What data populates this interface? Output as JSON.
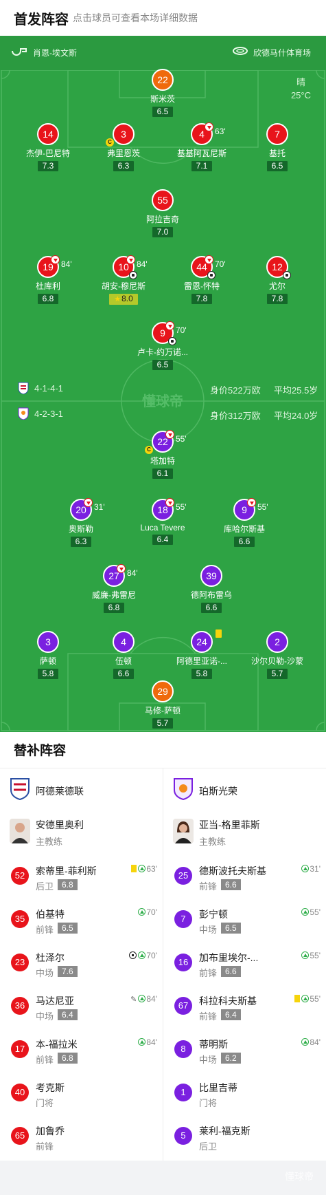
{
  "header": {
    "title": "首发阵容",
    "subtitle": "点击球员可查看本场详细数据"
  },
  "pitch_info": {
    "home_coach": "肖恩-埃文斯",
    "venue": "欣德马什体育场",
    "weather": "晴",
    "temperature": "25°C",
    "watermark": "懂球帝"
  },
  "home_meta": {
    "formation": "4-1-4-1",
    "value": "身价522万欧",
    "age": "平均25.5岁"
  },
  "away_meta": {
    "formation": "4-2-3-1",
    "value": "身价312万欧",
    "age": "平均24.0岁"
  },
  "home_players": [
    {
      "num": "22",
      "name": "斯米茨",
      "rating": "6.5"
    },
    {
      "num": "14",
      "name": "杰伊-巴尼特",
      "rating": "7.3"
    },
    {
      "num": "3",
      "name": "弗里恩茨",
      "rating": "6.3"
    },
    {
      "num": "4",
      "name": "基基阿瓦尼斯",
      "rating": "7.1",
      "sub_time": "63'"
    },
    {
      "num": "7",
      "name": "基托",
      "rating": "6.5"
    },
    {
      "num": "55",
      "name": "阿拉吉奇",
      "rating": "7.0"
    },
    {
      "num": "19",
      "name": "杜库利",
      "rating": "6.8",
      "sub_time": "84'"
    },
    {
      "num": "10",
      "name": "胡安-穆尼斯",
      "rating": "8.0",
      "sub_time": "84'"
    },
    {
      "num": "44",
      "name": "雷恩-怀特",
      "rating": "7.8",
      "sub_time": "70'"
    },
    {
      "num": "12",
      "name": "尤尔",
      "rating": "7.8"
    },
    {
      "num": "9",
      "name": "卢卡-约万诺...",
      "rating": "6.5",
      "sub_time": "70'"
    }
  ],
  "away_players": [
    {
      "num": "22",
      "name": "塔加特",
      "rating": "6.1",
      "sub_time": "55'"
    },
    {
      "num": "20",
      "name": "奥斯勒",
      "rating": "6.3",
      "sub_time": "31'"
    },
    {
      "num": "18",
      "name": "Luca Tevere",
      "rating": "6.4",
      "sub_time": "55'"
    },
    {
      "num": "9",
      "name": "库哈尔斯基",
      "rating": "6.6",
      "sub_time": "55'"
    },
    {
      "num": "27",
      "name": "威廉-弗雷尼",
      "rating": "6.8",
      "sub_time": "84'"
    },
    {
      "num": "39",
      "name": "德阿布雷乌",
      "rating": "6.6"
    },
    {
      "num": "3",
      "name": "萨顿",
      "rating": "5.8"
    },
    {
      "num": "4",
      "name": "伍顿",
      "rating": "6.6"
    },
    {
      "num": "24",
      "name": "阿德里亚诺-...",
      "rating": "5.8"
    },
    {
      "num": "2",
      "name": "沙尔贝勒-沙蒙",
      "rating": "5.7"
    },
    {
      "num": "29",
      "name": "马修-萨顿",
      "rating": "5.7"
    }
  ],
  "subs": {
    "title": "替补阵容",
    "home_team": "阿德莱德联",
    "away_team": "珀斯光荣",
    "home_coach": {
      "name": "安德里奥利",
      "role": "主教练"
    },
    "away_coach": {
      "name": "亚当-格里菲斯",
      "role": "主教练"
    },
    "home": [
      {
        "num": "52",
        "name": "索蒂里-菲利斯",
        "pos": "后卫",
        "rating": "6.8",
        "time": "63'"
      },
      {
        "num": "35",
        "name": "伯基特",
        "pos": "前锋",
        "rating": "6.5",
        "time": "70'"
      },
      {
        "num": "23",
        "name": "杜泽尔",
        "pos": "中场",
        "rating": "7.6",
        "time": "70'"
      },
      {
        "num": "36",
        "name": "马达尼亚",
        "pos": "中场",
        "rating": "6.4",
        "time": "84'"
      },
      {
        "num": "17",
        "name": "本-福拉米",
        "pos": "前锋",
        "rating": "6.8",
        "time": "84'"
      },
      {
        "num": "40",
        "name": "考克斯",
        "pos": "门将"
      },
      {
        "num": "65",
        "name": "加鲁乔",
        "pos": "前锋"
      }
    ],
    "away": [
      {
        "num": "25",
        "name": "德斯波托夫斯基",
        "pos": "前锋",
        "rating": "6.6",
        "time": "31'"
      },
      {
        "num": "7",
        "name": "彭宁顿",
        "pos": "中场",
        "rating": "6.5",
        "time": "55'"
      },
      {
        "num": "16",
        "name": "加布里埃尔-...",
        "pos": "前锋",
        "rating": "6.6",
        "time": "55'"
      },
      {
        "num": "67",
        "name": "科拉科夫斯基",
        "pos": "前锋",
        "rating": "6.4",
        "time": "55'"
      },
      {
        "num": "8",
        "name": "蒂明斯",
        "pos": "中场",
        "rating": "6.2",
        "time": "84'"
      },
      {
        "num": "1",
        "name": "比里吉蒂",
        "pos": "门将"
      },
      {
        "num": "5",
        "name": "莱利-福克斯",
        "pos": "后卫"
      }
    ]
  },
  "footer": "懂球帝"
}
